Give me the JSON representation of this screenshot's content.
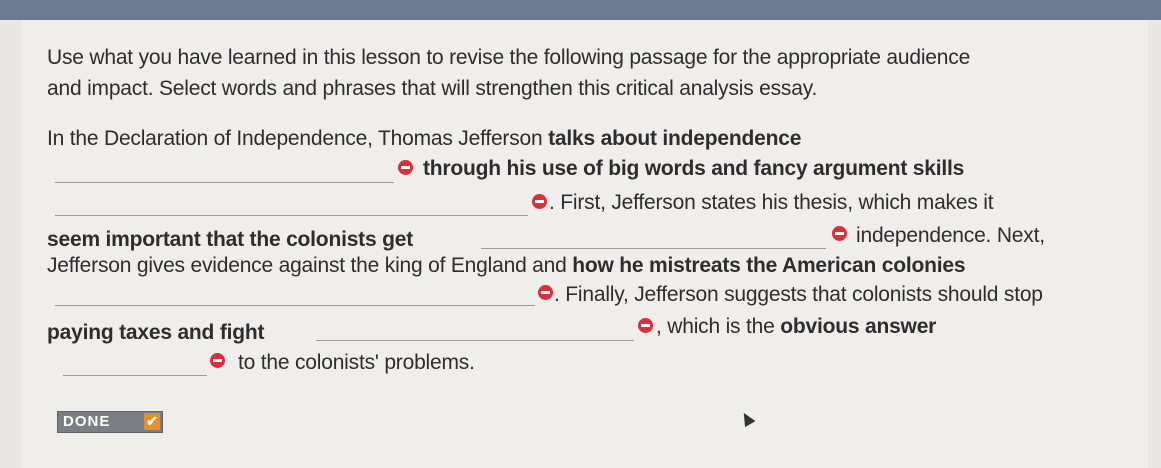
{
  "prompt": {
    "line1": "Use what you have learned in this lesson to revise the following passage for the appropriate audience",
    "line2": "and impact. Select words and phrases that will strengthen this critical analysis essay."
  },
  "passage": {
    "p1": "In the Declaration of Independence, Thomas Jefferson ",
    "p1_b": "talks about independence",
    "p2_b": "through his use of big words and fancy argument skills",
    "p3": ". First, Jefferson states his thesis, which makes it",
    "p4_b": "seem important that the colonists get",
    "p5": "independence. Next,",
    "p6": "Jefferson gives evidence against the king of England and ",
    "p6_b": "how he mistreats the American colonies",
    "p7": ". Finally, Jefferson suggests that colonists should stop",
    "p8_b": "paying taxes and fight",
    "p9": ", which is the ",
    "p9_b": "obvious answer",
    "p10": "to the colonists' problems."
  },
  "done_button": {
    "label": "DONE",
    "check": "✔"
  },
  "colors": {
    "accent_remove": "#d8303c",
    "done_bg": "#7b7f85",
    "done_check": "#e5902a",
    "topbar": "#6f7a92"
  }
}
